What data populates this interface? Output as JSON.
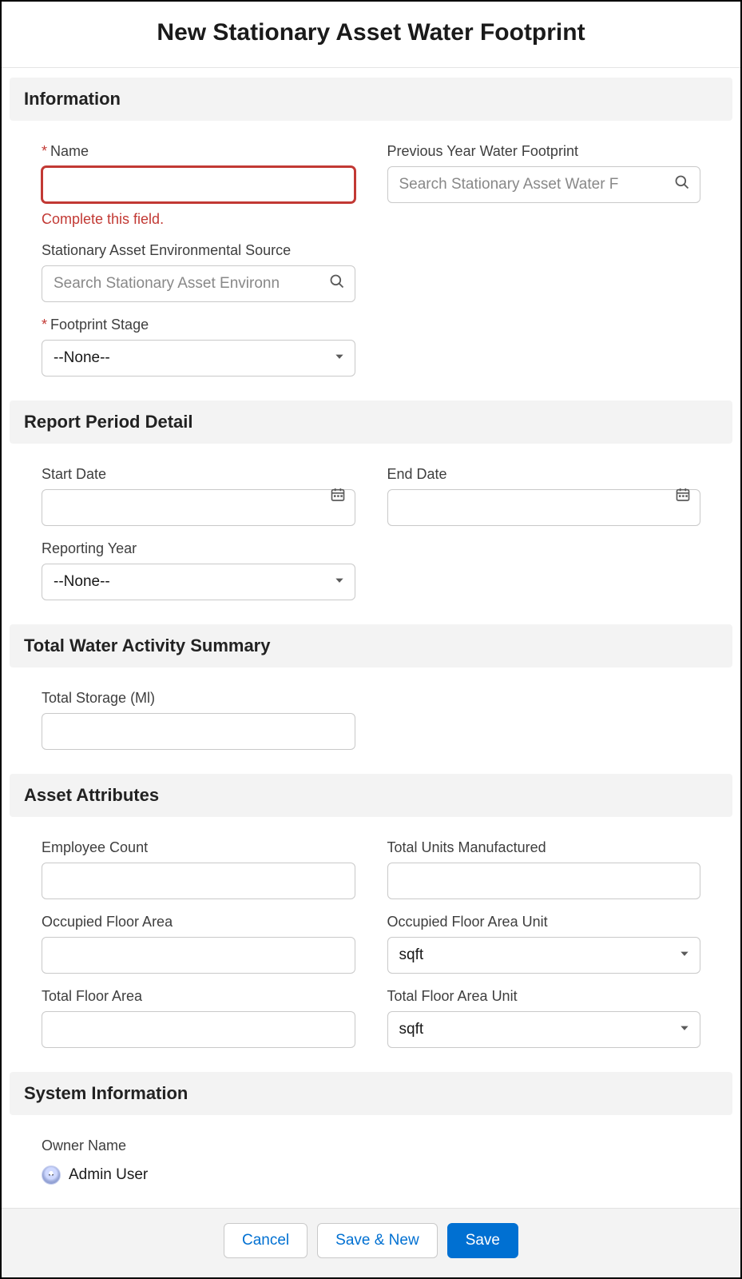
{
  "title": "New Stationary Asset Water Footprint",
  "sections": {
    "information": "Information",
    "report": "Report Period Detail",
    "water": "Total Water Activity Summary",
    "asset": "Asset Attributes",
    "system": "System Information"
  },
  "fields": {
    "name": {
      "label": "Name",
      "error": "Complete this field."
    },
    "prev": {
      "label": "Previous Year Water Footprint",
      "placeholder": "Search Stationary Asset Water F"
    },
    "source": {
      "label": "Stationary Asset Environmental Source",
      "placeholder": "Search Stationary Asset Environn"
    },
    "stage": {
      "label": "Footprint Stage",
      "value": "--None--"
    },
    "start": {
      "label": "Start Date"
    },
    "end": {
      "label": "End Date"
    },
    "year": {
      "label": "Reporting Year",
      "value": "--None--"
    },
    "storage": {
      "label": "Total Storage (Ml)"
    },
    "employee": {
      "label": "Employee Count"
    },
    "units": {
      "label": "Total Units Manufactured"
    },
    "occArea": {
      "label": "Occupied Floor Area"
    },
    "occUnit": {
      "label": "Occupied Floor Area Unit",
      "value": "sqft"
    },
    "totArea": {
      "label": "Total Floor Area"
    },
    "totUnit": {
      "label": "Total Floor Area Unit",
      "value": "sqft"
    },
    "owner": {
      "label": "Owner Name",
      "value": "Admin User"
    }
  },
  "buttons": {
    "cancel": "Cancel",
    "saveNew": "Save & New",
    "save": "Save"
  }
}
